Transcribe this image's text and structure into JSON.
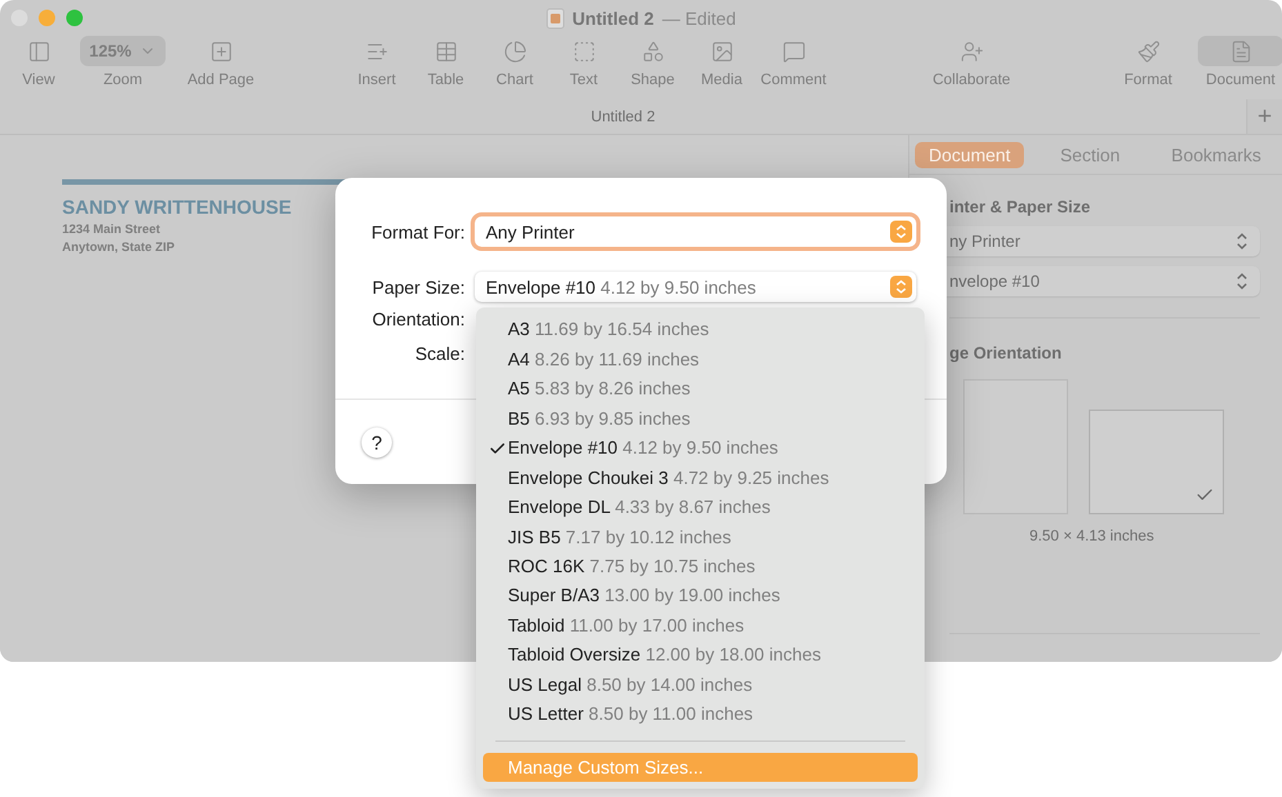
{
  "window": {
    "title": "Untitled 2",
    "edited": "— Edited"
  },
  "toolbar": [
    {
      "items": [
        {
          "label": "View",
          "kind": "button",
          "selected": false
        },
        {
          "label": "Zoom",
          "kind": "dropdown",
          "value": "125%"
        },
        {
          "label": "Add Page",
          "kind": "button",
          "selected": false
        }
      ]
    },
    {
      "items": [
        {
          "label": "Insert",
          "kind": "button",
          "selected": false
        },
        {
          "label": "Table",
          "kind": "button",
          "selected": false
        },
        {
          "label": "Chart",
          "kind": "button",
          "selected": false
        },
        {
          "label": "Text",
          "kind": "button",
          "selected": false
        },
        {
          "label": "Shape",
          "kind": "button",
          "selected": false
        },
        {
          "label": "Media",
          "kind": "button",
          "selected": false
        },
        {
          "label": "Comment",
          "kind": "button",
          "selected": false
        }
      ]
    },
    {
      "items": [
        {
          "label": "Collaborate",
          "kind": "button",
          "selected": false
        }
      ]
    },
    {
      "items": [
        {
          "label": "Format",
          "kind": "button",
          "selected": false
        },
        {
          "label": "Document",
          "kind": "button",
          "selected": true
        }
      ]
    }
  ],
  "tab_bar": {
    "tab": "Untitled 2",
    "add_button": "+"
  },
  "document": {
    "name": "SANDY WRITTENHOUSE",
    "address": [
      "1234 Main Street",
      "Anytown, State ZIP"
    ]
  },
  "sidebar": {
    "tabs": [
      {
        "label": "Document",
        "selected": true
      },
      {
        "label": "Section",
        "selected": false
      },
      {
        "label": "Bookmarks",
        "selected": false
      }
    ],
    "paper_heading": "inter & Paper Size",
    "printer": "ny Printer",
    "paper": "nvelope #10",
    "orientation_heading": "ge Orientation",
    "orientations": [
      {
        "kind": "portrait",
        "selected": false
      },
      {
        "kind": "landscape",
        "selected": true
      }
    ],
    "dimensions": "9.50 × 4.13 inches"
  },
  "dialog": {
    "format_for": {
      "label": "Format For:",
      "value": "Any Printer",
      "focused": true
    },
    "paper_size": {
      "label": "Paper Size:",
      "value": "Envelope #10",
      "detail": "4.12 by 9.50 inches",
      "focused": false
    },
    "orientation_label": "Orientation:",
    "scale_label": "Scale:",
    "help": "?"
  },
  "menu": [
    {
      "kind": "size",
      "name": "A3",
      "size": "11.69 by 16.54 inches",
      "checked": false
    },
    {
      "kind": "size",
      "name": "A4",
      "size": "8.26 by 11.69 inches",
      "checked": false
    },
    {
      "kind": "size",
      "name": "A5",
      "size": "5.83 by 8.26 inches",
      "checked": false
    },
    {
      "kind": "size",
      "name": "B5",
      "size": "6.93 by 9.85 inches",
      "checked": false
    },
    {
      "kind": "size",
      "name": "Envelope #10",
      "size": "4.12 by 9.50 inches",
      "checked": true
    },
    {
      "kind": "size",
      "name": "Envelope Choukei 3",
      "size": "4.72 by 9.25 inches",
      "checked": false
    },
    {
      "kind": "size",
      "name": "Envelope DL",
      "size": "4.33 by 8.67 inches",
      "checked": false
    },
    {
      "kind": "size",
      "name": "JIS B5",
      "size": "7.17 by 10.12 inches",
      "checked": false
    },
    {
      "kind": "size",
      "name": "ROC 16K",
      "size": "7.75 by 10.75 inches",
      "checked": false
    },
    {
      "kind": "size",
      "name": "Super B/A3",
      "size": "13.00 by 19.00 inches",
      "checked": false
    },
    {
      "kind": "size",
      "name": "Tabloid",
      "size": "11.00 by 17.00 inches",
      "checked": false
    },
    {
      "kind": "size",
      "name": "Tabloid Oversize",
      "size": "12.00 by 18.00 inches",
      "checked": false
    },
    {
      "kind": "size",
      "name": "US Legal",
      "size": "8.50 by 14.00 inches",
      "checked": false
    },
    {
      "kind": "size",
      "name": "US Letter",
      "size": "8.50 by 11.00 inches",
      "checked": false
    },
    {
      "kind": "separator"
    },
    {
      "kind": "action",
      "name": "Manage Custom Sizes...",
      "highlighted": true
    }
  ]
}
